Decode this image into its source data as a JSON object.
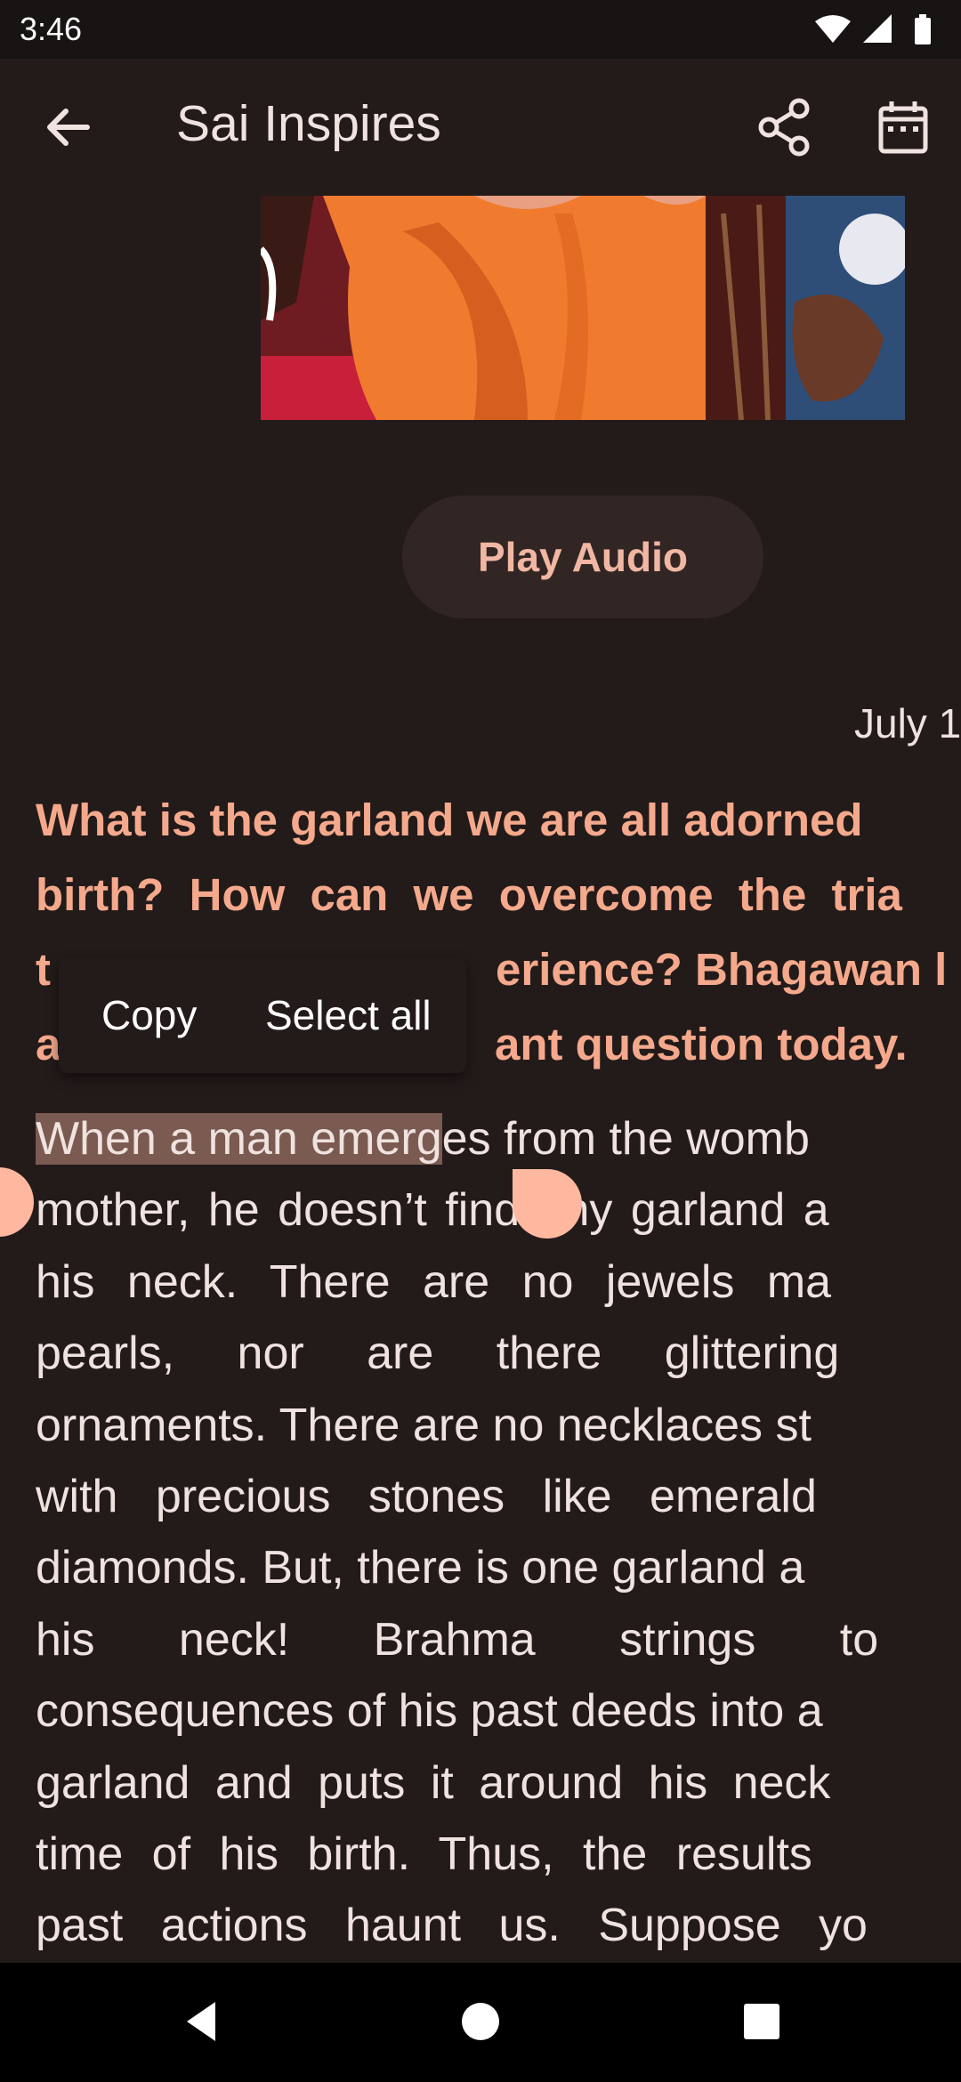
{
  "status_bar": {
    "time": "3:46",
    "icons": [
      "wifi-icon",
      "cellular-signal-icon",
      "battery-icon"
    ]
  },
  "app_bar": {
    "title": "Sai Inspires",
    "back_icon": "arrow-back-icon",
    "share_icon": "share-icon",
    "calendar_icon": "calendar-icon"
  },
  "article": {
    "play_audio_label": "Play Audio",
    "date": "July 1",
    "intro_lines": [
      "What is the garland we are all adorned",
      "birth? How can we overcome the tria",
      "t",
      "erience? Bhagawan l",
      "a",
      "ant question today."
    ],
    "body_selected": "When a man emerg",
    "body_first_rest": "es from the womb",
    "body_lines": [
      "mother, he doesn’t find any garland a",
      "his neck. There are no jewels ma",
      "pearls, nor are there glittering",
      "ornaments. There are no necklaces st",
      "with precious stones like emerald",
      "diamonds. But, there is one garland a",
      "his neck! Brahma strings to",
      "consequences of his past deeds into a",
      "garland and puts it around his neck",
      "time of his birth. Thus, the results",
      "past actions haunt us. Suppose yo"
    ]
  },
  "context_menu": {
    "copy_label": "Copy",
    "select_all_label": "Select all"
  },
  "nav_bar": {
    "back_icon": "nav-back-icon",
    "home_icon": "nav-home-icon",
    "recents_icon": "nav-recents-icon"
  },
  "colors": {
    "background": "#231b1a",
    "accent": "#f5a98c",
    "selection": "#7a5a51",
    "handle": "#ffb8a0"
  }
}
